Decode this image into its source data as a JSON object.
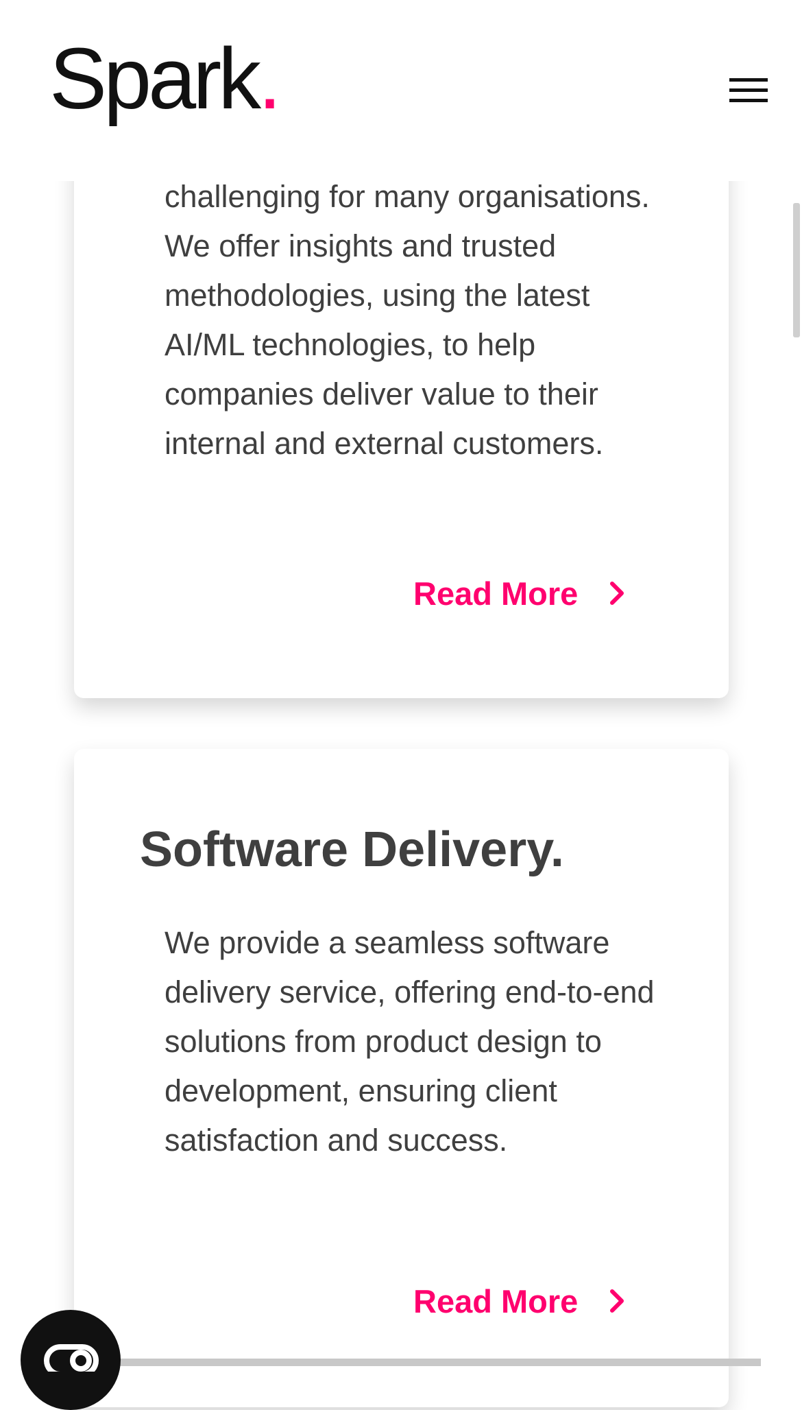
{
  "header": {
    "logo_text": "Spark",
    "logo_dot": ".",
    "menu_icon": "hamburger-menu-icon"
  },
  "cards": [
    {
      "clipped_text": "challenging for many",
      "description": "organisations. We offer insights and trusted methodologies, using the latest AI/ML technologies, to help companies deliver value to their internal and external customers.",
      "read_more_label": "Read More",
      "read_more_icon": "chevron-right-icon"
    },
    {
      "title": "Software Delivery.",
      "description": "We provide a seamless software delivery service, offering end-to-end solutions from product design to development, ensuring client satisfaction and success.",
      "read_more_label": "Read More",
      "read_more_icon": "chevron-right-icon"
    }
  ],
  "floating_button": {
    "icon": "chat-icon"
  },
  "colors": {
    "accent": "#ff006e",
    "text": "#3f3f3f",
    "logo": "#111111",
    "background": "#ffffff"
  }
}
